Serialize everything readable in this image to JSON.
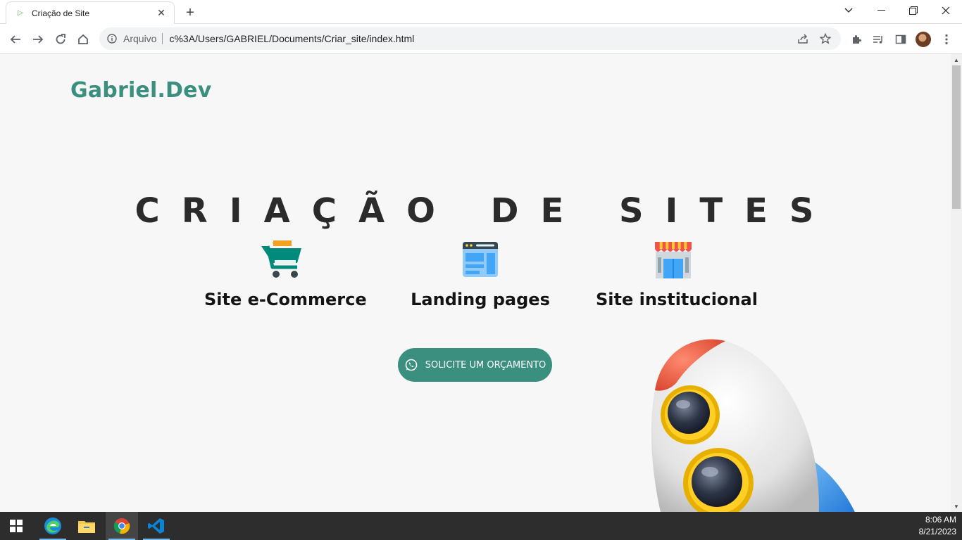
{
  "browser": {
    "tab_title": "Criação de Site",
    "omnibox_label": "Arquivo",
    "url": "c%3A/Users/GABRIEL/Documents/Criar_site/index.html"
  },
  "page": {
    "logo": "Gabriel.Dev",
    "hero_title": "CRIAÇÃO DE SITES",
    "services": [
      {
        "label": "Site e-Commerce",
        "icon": "shopping-cart-icon"
      },
      {
        "label": "Landing pages",
        "icon": "browser-window-icon"
      },
      {
        "label": "Site institucional",
        "icon": "storefront-icon"
      }
    ],
    "cta_label": "SOLICITE UM ORÇAMENTO",
    "accent_color": "#3a8f7f"
  },
  "taskbar": {
    "time": "8:06 AM",
    "date": "8/21/2023",
    "apps": [
      "windows-start-icon",
      "edge-icon",
      "file-explorer-icon",
      "chrome-icon",
      "vscode-icon"
    ]
  }
}
